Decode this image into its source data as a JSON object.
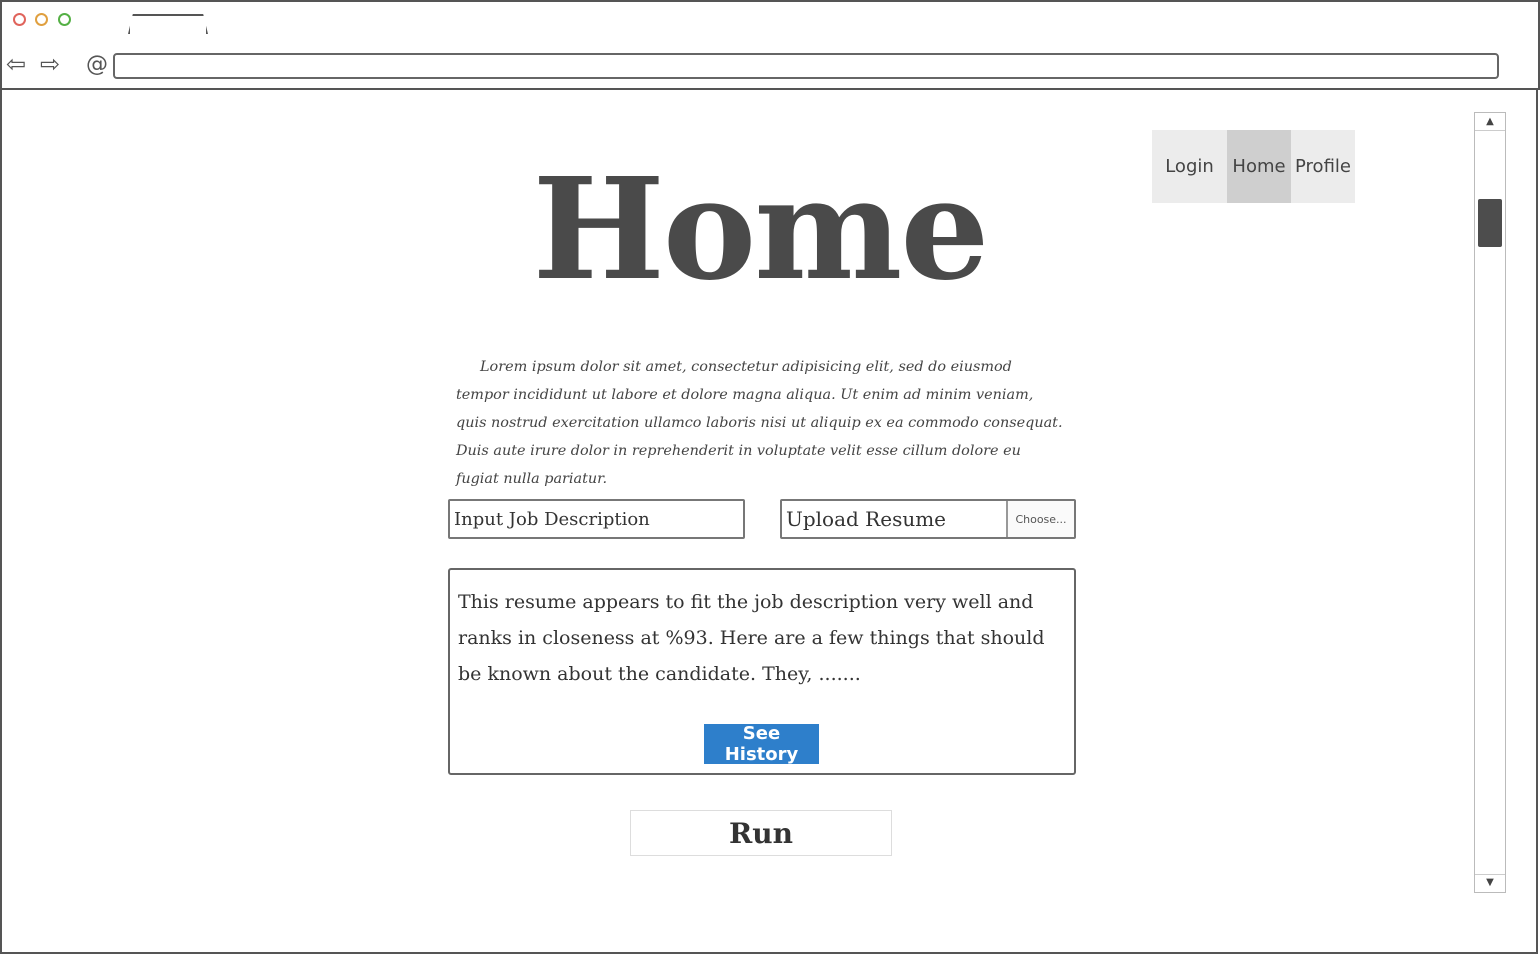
{
  "browser": {
    "back_icon": "arrow-left-icon",
    "forward_icon": "arrow-right-icon",
    "reload_icon": "reload-icon",
    "url": ""
  },
  "nav": {
    "items": [
      {
        "label": "Login",
        "active": false
      },
      {
        "label": "Home",
        "active": true
      },
      {
        "label": "Profile",
        "active": false
      }
    ]
  },
  "page": {
    "title": "Home",
    "intro": "Lorem ipsum dolor sit amet, consectetur adipisicing elit, sed do eiusmod tempor incididunt ut labore et dolore magna aliqua. Ut enim ad minim veniam, quis nostrud exercitation ullamco laboris nisi ut aliquip ex ea commodo consequat. Duis aute irure dolor in reprehenderit in voluptate velit esse cillum dolore eu fugiat nulla pariatur."
  },
  "form": {
    "job_description_placeholder": "Input Job Description",
    "upload_label": "Upload Resume",
    "choose_label": "Choose..."
  },
  "result": {
    "text": "This resume appears to fit the job description very well and ranks in closeness at %93. Here are a few things that should be known about the candidate. They, .......",
    "history_button": "See History"
  },
  "run_button": "Run",
  "colors": {
    "accent": "#2e7fcb",
    "nav_active": "#cfcfcf",
    "nav_bg": "#ececec"
  }
}
